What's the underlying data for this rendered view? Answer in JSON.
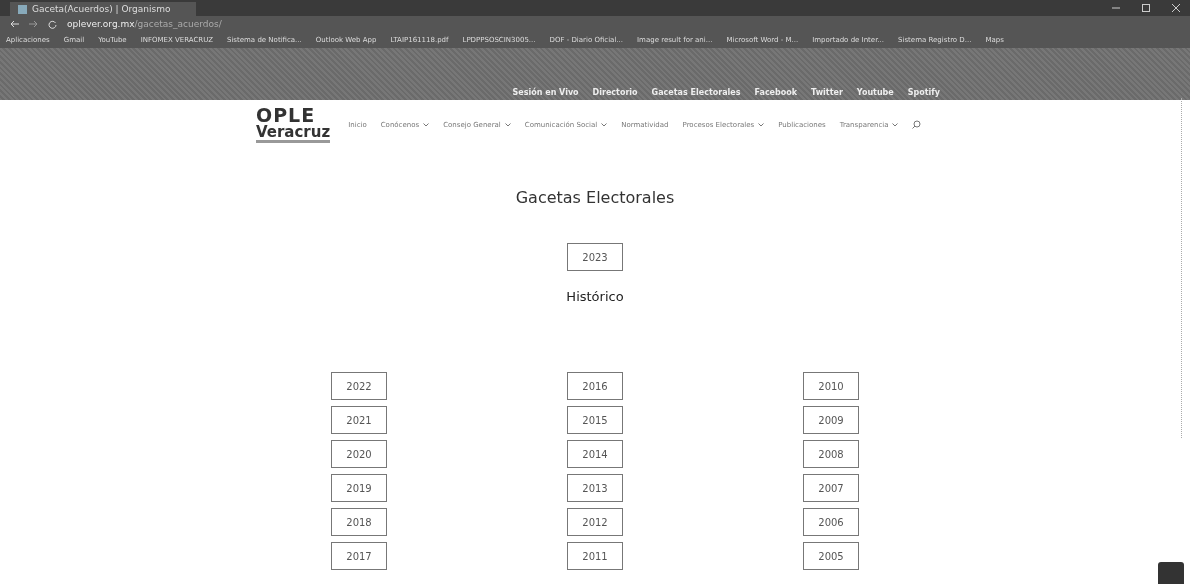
{
  "browser": {
    "tab": {
      "title": "Gaceta(Acuerdos) | Organismo",
      "selected": true
    },
    "url": {
      "domain": "oplever.org.mx",
      "path": "/gacetas_acuerdos/"
    },
    "bookmarks": [
      "Aplicaciones",
      "Gmail",
      "YouTube",
      "INFOMEX VERACRUZ",
      "Sistema de Notifica...",
      "Outlook Web App",
      "LTAIP161118.pdf",
      "LPDPPSOSCIN3005...",
      "DOF - Diario Oficial...",
      "Image result for ani...",
      "Microsoft Word - M...",
      "Importado de Inter...",
      "Sistema Registro D...",
      "Maps"
    ]
  },
  "top_links": [
    "Sesión en Vivo",
    "Directorio",
    "Gacetas Electorales",
    "Facebook",
    "Twitter",
    "Youtube",
    "Spotify"
  ],
  "logo": {
    "line_1": "OPLE",
    "line_2": "Veracruz"
  },
  "nav": [
    {
      "label": "Inicio",
      "dropdown": false
    },
    {
      "label": "Conócenos",
      "dropdown": true
    },
    {
      "label": "Consejo General",
      "dropdown": true
    },
    {
      "label": "Comunicación Social",
      "dropdown": true
    },
    {
      "label": "Normatividad",
      "dropdown": false
    },
    {
      "label": "Procesos Electorales",
      "dropdown": true
    },
    {
      "label": "Publicaciones",
      "dropdown": false
    },
    {
      "label": "Transparencia",
      "dropdown": true
    }
  ],
  "title": "Gacetas Electorales",
  "current": [
    "2023"
  ],
  "history_title": "Histórico",
  "history_columns": [
    [
      "2022",
      "2021",
      "2020",
      "2019",
      "2018",
      "2017"
    ],
    [
      "2016",
      "2015",
      "2014",
      "2013",
      "2012",
      "2011"
    ],
    [
      "2010",
      "2009",
      "2008",
      "2007",
      "2006",
      "2005"
    ]
  ]
}
